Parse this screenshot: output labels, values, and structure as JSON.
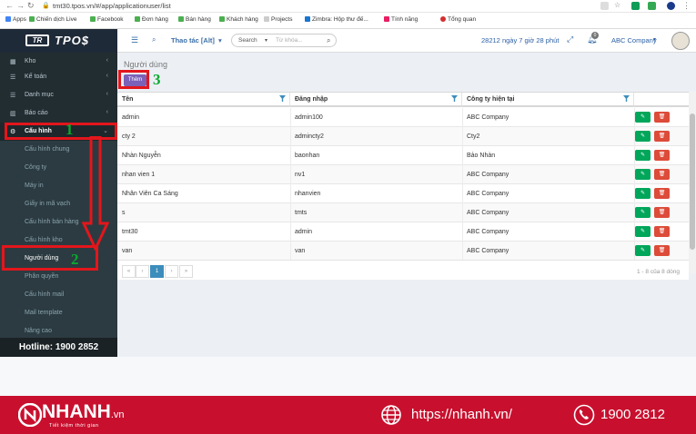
{
  "browser": {
    "url": "tmt30.tpos.vn/#/app/applicationuser/list",
    "bookmarks": [
      "Apps",
      "Chiến dịch Live",
      "Facebook",
      "Đơn hàng",
      "Bán hàng",
      "Khách hàng",
      "Projects",
      "Zimbra: Hộp thư đế...",
      "Tính năng",
      "Tổng quan"
    ]
  },
  "topbar": {
    "logo_mark": "TR",
    "logo_text": "TPO$",
    "actions_label": "Thao tác [Alt]",
    "search_scope": "Search",
    "search_placeholder": "Từ khóa...",
    "date_text": "28212 ngày 7 giờ 28 phút",
    "notification_count": "0",
    "company": "ABC Company"
  },
  "sidebar": {
    "items": [
      {
        "label": "Kho"
      },
      {
        "label": "Kế toán"
      },
      {
        "label": "Danh mục"
      },
      {
        "label": "Báo cáo"
      },
      {
        "label": "Cấu hình"
      }
    ],
    "subitems": [
      {
        "label": "Cấu hình chung"
      },
      {
        "label": "Công ty"
      },
      {
        "label": "Máy in"
      },
      {
        "label": "Giấy in mã vạch"
      },
      {
        "label": "Cấu hình bán hàng"
      },
      {
        "label": "Cấu hình kho"
      },
      {
        "label": "Người dùng"
      },
      {
        "label": "Phân quyền"
      },
      {
        "label": "Cấu hình mail"
      },
      {
        "label": "Mail template"
      },
      {
        "label": "Nâng cao"
      }
    ],
    "hotline": "Hotline: 1900 2852"
  },
  "main": {
    "title": "Người dùng",
    "add_label": "Thêm",
    "columns": [
      "Tên",
      "Đăng nhập",
      "Công ty hiện tại"
    ],
    "rows": [
      [
        "admin",
        "admin100",
        "ABC Company"
      ],
      [
        "cty 2",
        "admincty2",
        "Cty2"
      ],
      [
        "Nhàn Nguyễn",
        "baonhan",
        "Bảo Nhàn"
      ],
      [
        "nhan vien 1",
        "nv1",
        "ABC Company"
      ],
      [
        "Nhân Viên Ca Sáng",
        "nhanvien",
        "ABC Company"
      ],
      [
        "s",
        "tmts",
        "ABC Company"
      ],
      [
        "tmt30",
        "admin",
        "ABC Company"
      ],
      [
        "van",
        "van",
        "ABC Company"
      ]
    ],
    "pager": {
      "first": "«",
      "prev": "‹",
      "current": "1",
      "next": "›",
      "last": "»",
      "info": "1 - 8 của 8 dòng"
    }
  },
  "annotations": {
    "step1": "1",
    "step2": "2",
    "step3": "3"
  },
  "footer": {
    "brand": "NHANH",
    "brand_suffix": ".vn",
    "tagline": "Tiết kiệm thời gian",
    "url": "https://nhanh.vn/",
    "phone": "1900 2812"
  },
  "colors": {
    "sidebar": "#222d32",
    "accent_purple": "#7b61b8",
    "edit_green": "#00a65a",
    "delete_red": "#dd4b39",
    "annotation_red": "#e3161c",
    "annotation_green": "#0aa830",
    "footer_red": "#c8102e"
  }
}
